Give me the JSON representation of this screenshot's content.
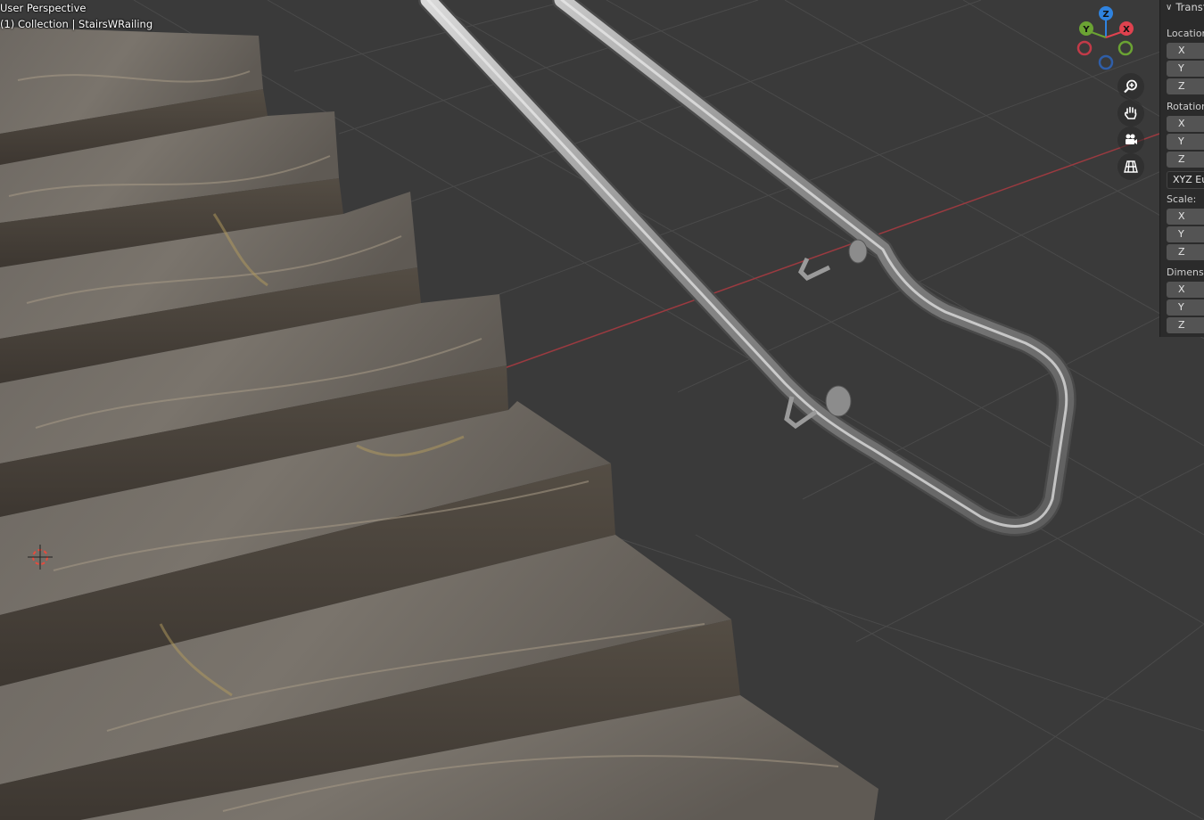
{
  "viewport": {
    "title": "User Perspective",
    "collection_label": "(1) Collection | StairsWRailing"
  },
  "gizmo": {
    "axes": [
      "Z",
      "Y",
      "X"
    ]
  },
  "nav_buttons": [
    "zoom-icon",
    "hand-pan-icon",
    "camera-icon",
    "grid-ortho-icon"
  ],
  "npanel": {
    "header": "Transform",
    "location": {
      "label": "Location:",
      "x": "X",
      "y": "Y",
      "z": "Z"
    },
    "rotation": {
      "label": "Rotation:",
      "x": "X",
      "y": "Y",
      "z": "Z",
      "mode": "XYZ Euler"
    },
    "scale": {
      "label": "Scale:",
      "x": "X",
      "y": "Y",
      "z": "Z"
    },
    "dimensions": {
      "label": "Dimensions:",
      "x": "X",
      "y": "Y",
      "z": "Z"
    }
  },
  "colors": {
    "background": "#3a3a3a",
    "grid": "#4a4a4a",
    "x_axis": "#9b3a40",
    "axis_x": "#e0424f",
    "axis_y": "#6ba333",
    "axis_z": "#2f83e0",
    "panel": "#2b2b2b"
  }
}
